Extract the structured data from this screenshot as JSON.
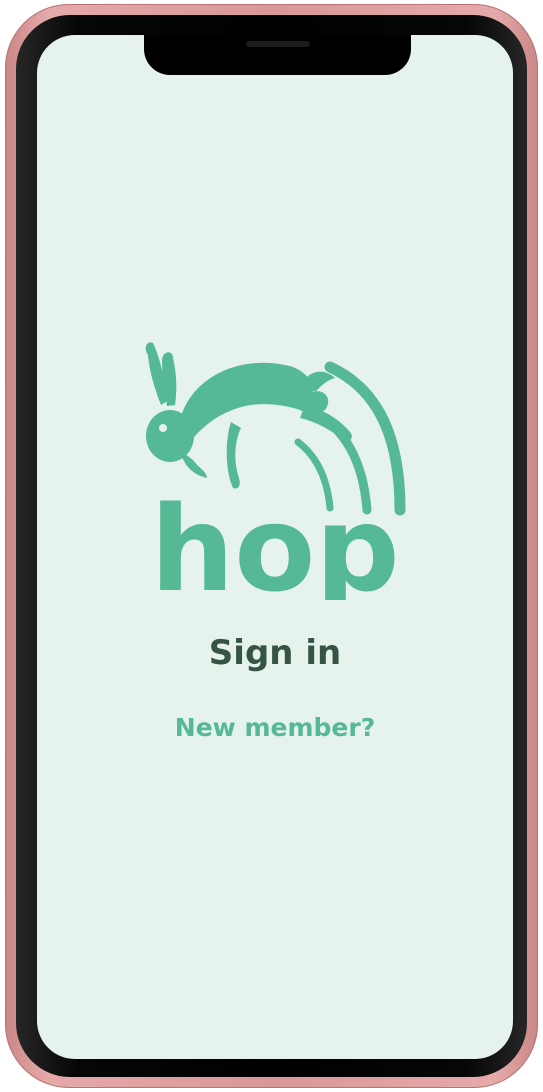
{
  "screen": {
    "background_color": "#e5f3ec",
    "logo": {
      "icon": "rabbit-logo-icon",
      "wordmark": "hop",
      "color": "#54b994"
    },
    "sign_in_label": "Sign in",
    "new_member_label": "New member?",
    "colors": {
      "primary_text": "#355446",
      "accent": "#54b994"
    }
  }
}
